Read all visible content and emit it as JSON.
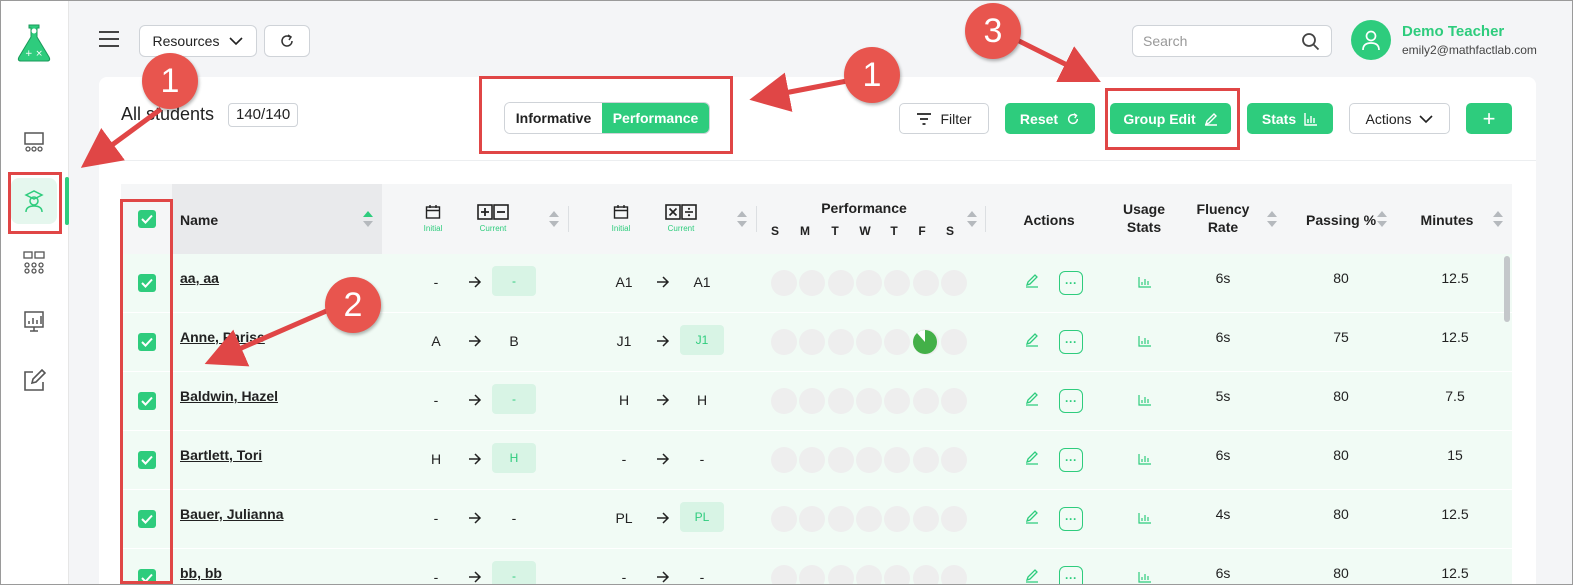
{
  "topbar": {
    "resources_label": "Resources",
    "search_placeholder": "Search",
    "user_name": "Demo Teacher",
    "user_email": "emily2@mathfactlab.com"
  },
  "header": {
    "title": "All students",
    "count": "140/140",
    "toggle_informative": "Informative",
    "toggle_performance": "Performance",
    "filter_label": "Filter",
    "reset_label": "Reset",
    "group_edit_label": "Group Edit",
    "stats_label": "Stats",
    "actions_label": "Actions",
    "add_label": "+"
  },
  "table": {
    "col_name": "Name",
    "col_performance": "Performance",
    "col_actions": "Actions",
    "col_usage_1": "Usage",
    "col_usage_2": "Stats",
    "col_fluency_1": "Fluency",
    "col_fluency_2": "Rate",
    "col_passing": "Passing %",
    "col_minutes": "Minutes",
    "initial_label": "Initial",
    "current_label": "Current",
    "days": [
      "S",
      "M",
      "T",
      "W",
      "T",
      "F",
      "S"
    ],
    "rows": [
      {
        "name": "aa, aa",
        "as_initial": "-",
        "as_current": "-",
        "md_initial": "A1",
        "md_current": "A1",
        "fluency": "6s",
        "passing": "80",
        "minutes": "12.5"
      },
      {
        "name": "Anne, Parise",
        "as_initial": "A",
        "as_current": "B",
        "md_initial": "J1",
        "md_current": "J1",
        "fluency": "6s",
        "passing": "75",
        "minutes": "12.5"
      },
      {
        "name": "Baldwin, Hazel",
        "as_initial": "-",
        "as_current": "-",
        "md_initial": "H",
        "md_current": "H",
        "fluency": "5s",
        "passing": "80",
        "minutes": "7.5"
      },
      {
        "name": "Bartlett, Tori",
        "as_initial": "H",
        "as_current": "H",
        "md_initial": "-",
        "md_current": "-",
        "fluency": "6s",
        "passing": "80",
        "minutes": "15"
      },
      {
        "name": "Bauer, Julianna",
        "as_initial": "-",
        "as_current": "-",
        "md_initial": "PL",
        "md_current": "PL",
        "fluency": "4s",
        "passing": "80",
        "minutes": "12.5"
      },
      {
        "name": "bb, bb",
        "as_initial": "-",
        "as_current": "-",
        "md_initial": "-",
        "md_current": "-",
        "fluency": "6s",
        "passing": "80",
        "minutes": "12.5"
      }
    ]
  },
  "annotations": [
    "1",
    "1",
    "2",
    "3"
  ],
  "colors": {
    "accent": "#2ecc7d",
    "annotation": "#e04646"
  }
}
